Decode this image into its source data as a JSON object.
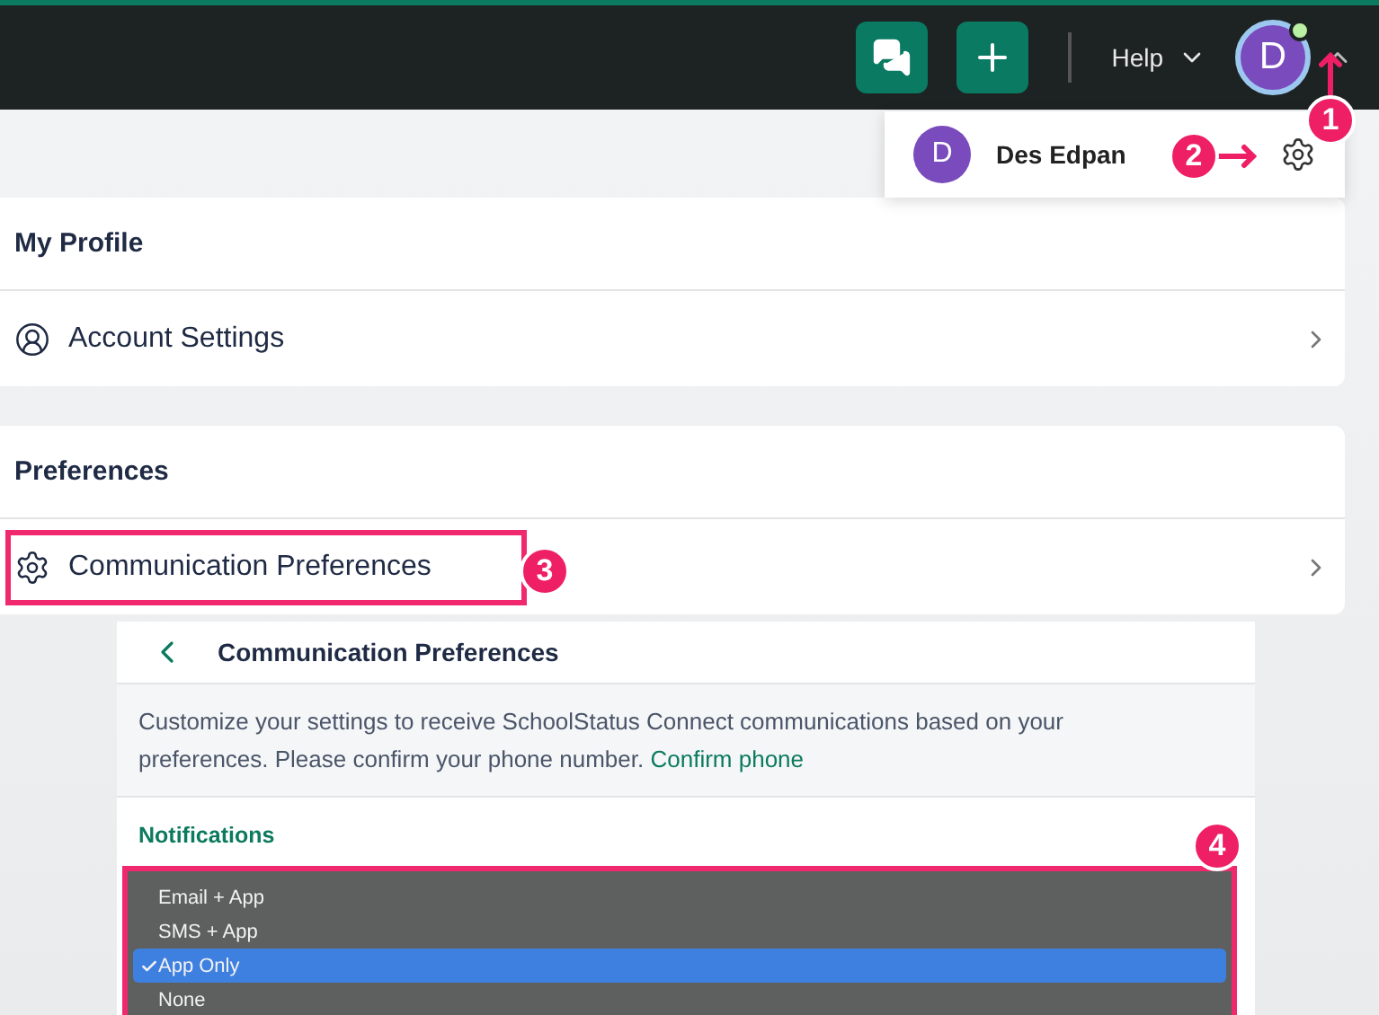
{
  "top_bar": {
    "help": "Help",
    "avatar_initial": "D",
    "online": true
  },
  "user_menu": {
    "avatar_initial": "D",
    "name": "Des Edpan"
  },
  "sections": [
    {
      "title": "My Profile",
      "items": [
        {
          "label": "Account Settings",
          "highlighted": false
        }
      ]
    },
    {
      "title": "Preferences",
      "items": [
        {
          "label": "Communication Preferences",
          "highlighted": true
        }
      ]
    }
  ],
  "communication_preferences": {
    "title": "Communication Preferences",
    "description": "Customize your settings to receive SchoolStatus Connect communications based on your preferences. Please confirm your phone number.",
    "link": "Confirm phone",
    "notifications_label": "Notifications",
    "menu": {
      "highlighted": true,
      "options": [
        {
          "label": "Email + App",
          "selected": false
        },
        {
          "label": "SMS + App",
          "selected": false
        },
        {
          "label": "App Only",
          "selected": true
        },
        {
          "label": "None",
          "selected": false
        }
      ]
    }
  },
  "callouts": [
    {
      "number": "1"
    },
    {
      "number": "2"
    },
    {
      "number": "3"
    },
    {
      "number": "4"
    }
  ]
}
